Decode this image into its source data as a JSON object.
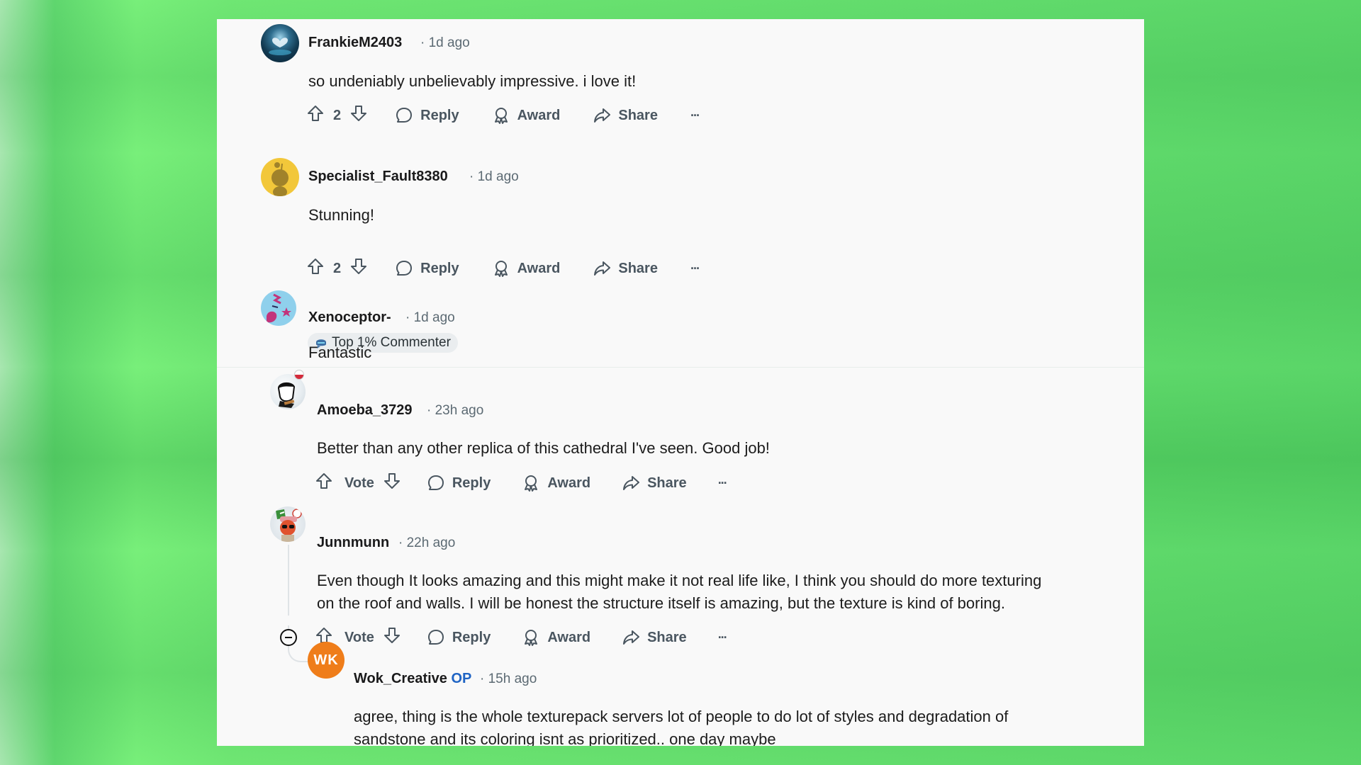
{
  "colors": {
    "card_bg": "#f9f9f9",
    "username": "#1a1a1b",
    "meta": "#5c6a73",
    "action": "#4a5660",
    "op_badge": "#1f64c4",
    "background": "#6fe673"
  },
  "actions": {
    "reply": "Reply",
    "award": "Award",
    "share": "Share",
    "more": "···",
    "vote": "Vote"
  },
  "comments": [
    {
      "username": "FrankieM2403",
      "time": "· 1d ago",
      "text": "so undeniably unbelievably impressive. i love it!",
      "score": "2",
      "avatar": "frankie-avatar"
    },
    {
      "username": "Specialist_Fault8380",
      "time": "· 1d ago",
      "text": "Stunning!",
      "score": "2",
      "avatar": "snoo-default-avatar"
    },
    {
      "username": "Xenoceptor-",
      "time": "· 1d ago",
      "badge": "Top 1% Commenter",
      "text": "Fantastic",
      "avatar": "xenoceptor-avatar"
    },
    {
      "username": "Amoeba_3729",
      "time": "· 23h ago",
      "text": "Better than any other replica of this cathedral I've seen. Good job!",
      "score": "Vote",
      "avatar": "amoeba-avatar"
    },
    {
      "username": "Junnmunn",
      "time": "· 22h ago",
      "text_lines": [
        "Even though It looks amazing and this might make it not real life like, I think you should do more texturing",
        "on the roof and walls. I will be honest the structure itself is amazing, but the texture is kind of boring."
      ],
      "score": "Vote",
      "avatar": "junnmunn-avatar"
    },
    {
      "username": "Wok_Creative",
      "op_label": "OP",
      "time": "· 15h ago",
      "text_lines": [
        "agree, thing is the whole texturepack servers lot of people to do lot of styles and degradation of",
        "sandstone and its coloring isnt as prioritized.. one day maybe"
      ],
      "avatar": "wok-creative-avatar",
      "avatar_text": "WK"
    }
  ]
}
